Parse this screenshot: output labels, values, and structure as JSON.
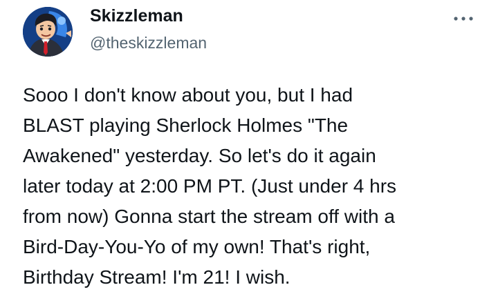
{
  "author": {
    "display_name": "Skizzleman",
    "handle": "@theskizzleman",
    "avatar_icon": "cartoon-avatar"
  },
  "actions": {
    "more_icon": "more-horizontal-icon"
  },
  "tweet": {
    "lines": [
      "Sooo I don't know about you, but I had",
      "BLAST playing Sherlock Holmes \"The",
      "Awakened\" yesterday. So let's do it again",
      "later today at 2:00 PM PT. (Just under 4 hrs",
      "from now) Gonna start the stream off with a",
      "Bird-Day-You-Yo of my own! That's right,",
      "Birthday Stream! I'm 21! I wish."
    ]
  },
  "colors": {
    "text": "#0f1419",
    "secondary": "#536471",
    "avatar_bg": "#123a7a"
  }
}
